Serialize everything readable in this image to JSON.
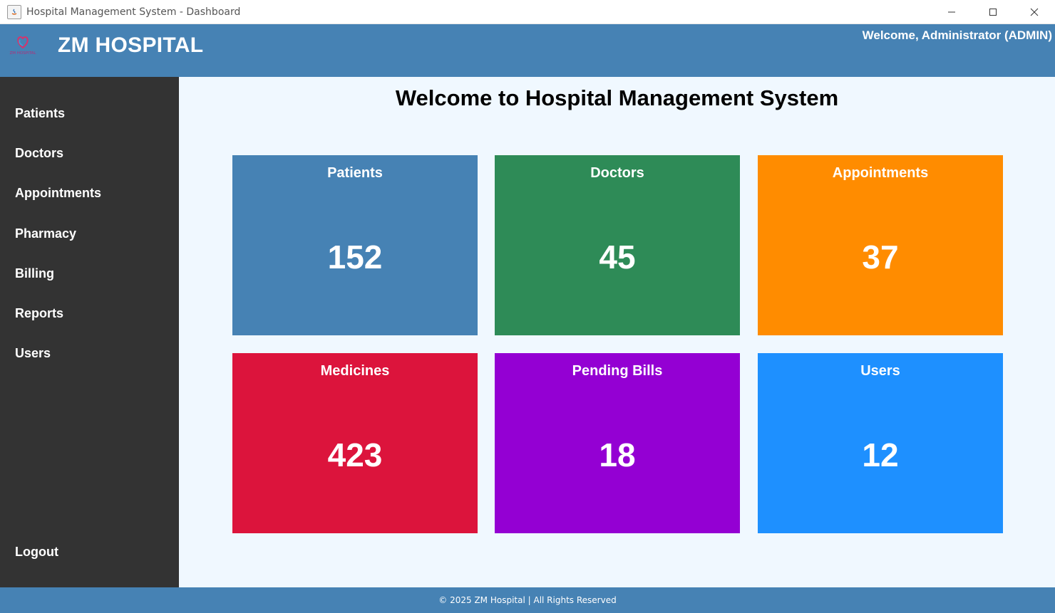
{
  "window": {
    "title": "Hospital Management System - Dashboard",
    "controls": [
      "minimize-icon",
      "maximize-icon",
      "close-icon"
    ]
  },
  "header": {
    "brand": "ZM HOSPITAL",
    "logo_text": "ZM HOSPITAL",
    "welcome": "Welcome, Administrator (ADMIN)",
    "color": "#4682b4"
  },
  "sidebar": {
    "items": [
      {
        "label": "Patients"
      },
      {
        "label": "Doctors"
      },
      {
        "label": "Appointments"
      },
      {
        "label": "Pharmacy"
      },
      {
        "label": "Billing"
      },
      {
        "label": "Reports"
      },
      {
        "label": "Users"
      }
    ],
    "logout": "Logout",
    "color": "#333333"
  },
  "main": {
    "title": "Welcome to Hospital Management System",
    "cards": [
      {
        "title": "Patients",
        "value": "152",
        "color": "#4682b4"
      },
      {
        "title": "Doctors",
        "value": "45",
        "color": "#2e8b57"
      },
      {
        "title": "Appointments",
        "value": "37",
        "color": "#ff8c00"
      },
      {
        "title": "Medicines",
        "value": "423",
        "color": "#dc143c"
      },
      {
        "title": "Pending Bills",
        "value": "18",
        "color": "#9400d3"
      },
      {
        "title": "Users",
        "value": "12",
        "color": "#1e90ff"
      }
    ]
  },
  "footer": {
    "text": "© 2025 ZM Hospital | All Rights Reserved"
  }
}
